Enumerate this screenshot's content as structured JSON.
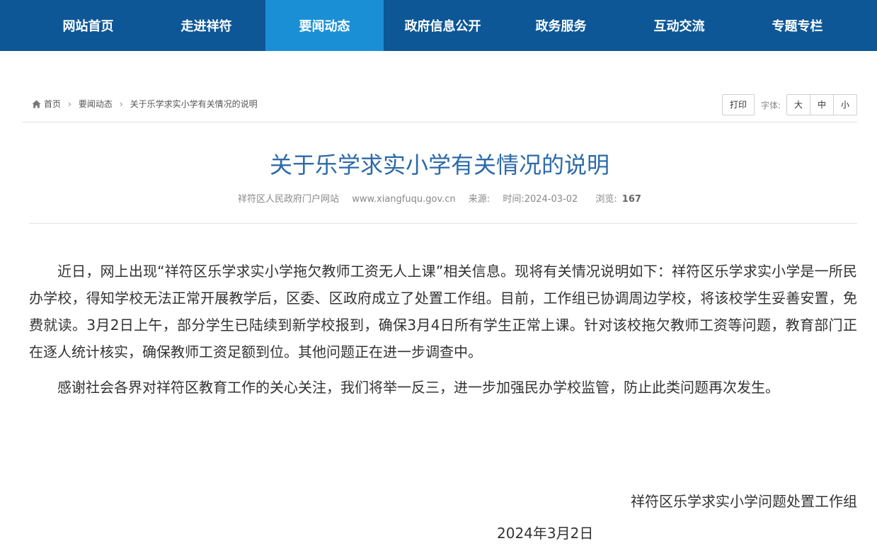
{
  "nav": {
    "items": [
      {
        "label": "网站首页"
      },
      {
        "label": "走进祥符"
      },
      {
        "label": "要闻动态"
      },
      {
        "label": "政府信息公开"
      },
      {
        "label": "政务服务"
      },
      {
        "label": "互动交流"
      },
      {
        "label": "专题专栏"
      }
    ],
    "active": "要闻动态",
    "colors": {
      "bar": "#0d5797",
      "active": "#1b8fd6"
    }
  },
  "breadcrumb": {
    "home_icon": "home-icon",
    "home": "首页",
    "section": "要闻动态",
    "current": "关于乐学求实小学有关情况的说明"
  },
  "tools": {
    "print": "打印",
    "font_label": "字体:",
    "sizes": [
      "大",
      "中",
      "小"
    ]
  },
  "article": {
    "title": "关于乐学求实小学有关情况的说明",
    "meta": {
      "site": "祥符区人民政府门户网站",
      "url": "www.xiangfuqu.gov.cn",
      "source_label": "来源:",
      "time": "时间:2024-03-02",
      "views_label": "浏览:",
      "views": "167"
    },
    "paragraphs": [
      "近日，网上出现“祥符区乐学求实小学拖欠教师工资无人上课”相关信息。现将有关情况说明如下：祥符区乐学求实小学是一所民办学校，得知学校无法正常开展教学后，区委、区政府成立了处置工作组。目前，工作组已协调周边学校，将该校学生妥善安置，免费就读。3月2日上午，部分学生已陆续到新学校报到，确保3月4日所有学生正常上课。针对该校拖欠教师工资等问题，教育部门正在逐人统计核实，确保教师工资足额到位。其他问题正在进一步调查中。",
      "感谢社会各界对祥符区教育工作的关心关注，我们将举一反三，进一步加强民办学校监管，防止此类问题再次发生。"
    ],
    "signature": "祥符区乐学求实小学问题处置工作组",
    "date": "2024年3月2日",
    "title_color": "#2d6aa8"
  }
}
